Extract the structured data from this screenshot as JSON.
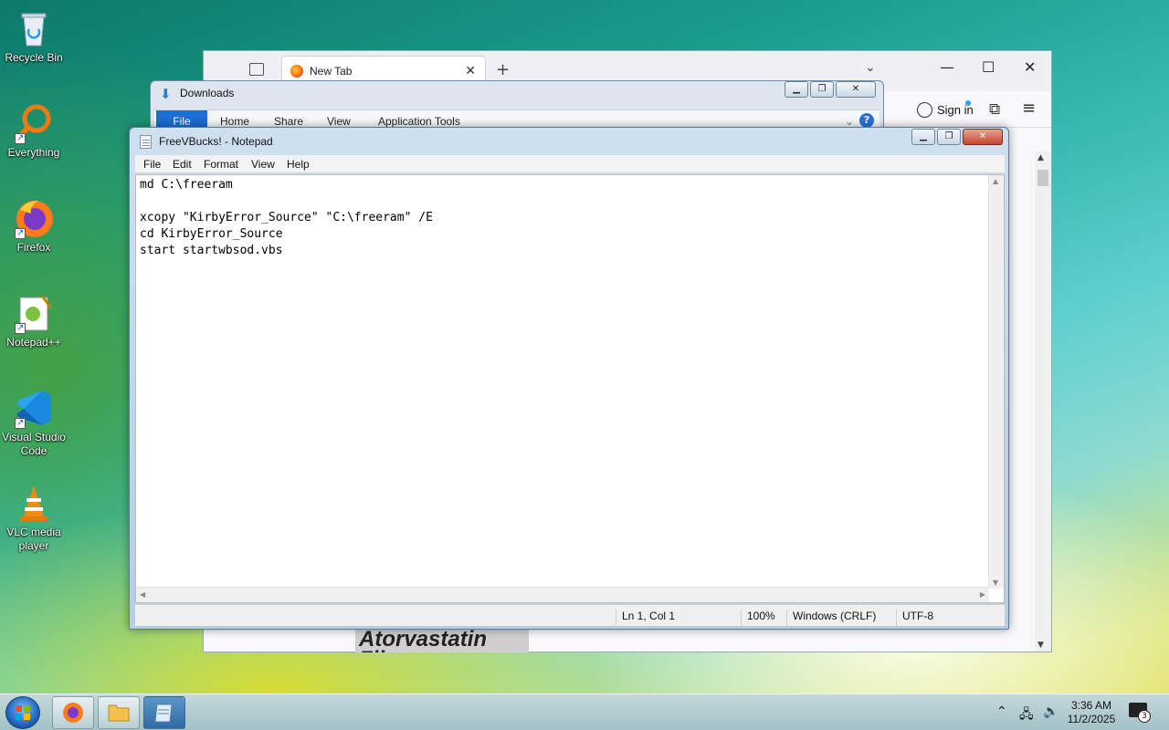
{
  "desktop": {
    "icons": [
      {
        "label": "Recycle Bin"
      },
      {
        "label": "Everything"
      },
      {
        "label": "Firefox"
      },
      {
        "label": "Notepad++"
      },
      {
        "label": "Visual Studio Code"
      },
      {
        "label": "VLC media player"
      }
    ]
  },
  "browser": {
    "tab_title": "New Tab",
    "sign_in_label": "Sign in",
    "background_image_text": "Atorvastatin Film"
  },
  "explorer": {
    "title": "Downloads",
    "ribbon_tabs": [
      "File",
      "Home",
      "Share",
      "View",
      "Application Tools"
    ],
    "help_label": "?"
  },
  "notepad": {
    "title": "FreeVBucks! - Notepad",
    "menu": [
      "File",
      "Edit",
      "Format",
      "View",
      "Help"
    ],
    "content": "md C:\\freeram\n\nxcopy \"KirbyError_Source\" \"C:\\freeram\" /E\ncd KirbyError_Source\nstart startwbsod.vbs",
    "status": {
      "position": "Ln 1, Col 1",
      "zoom": "100%",
      "line_ending": "Windows (CRLF)",
      "encoding": "UTF-8"
    }
  },
  "taskbar": {
    "clock_time": "3:36 AM",
    "clock_date": "11/2/2025",
    "notification_count": "3"
  },
  "colors": {
    "ribbon_file_blue": "#1b6ed3",
    "close_button_red": "#c7462e"
  }
}
